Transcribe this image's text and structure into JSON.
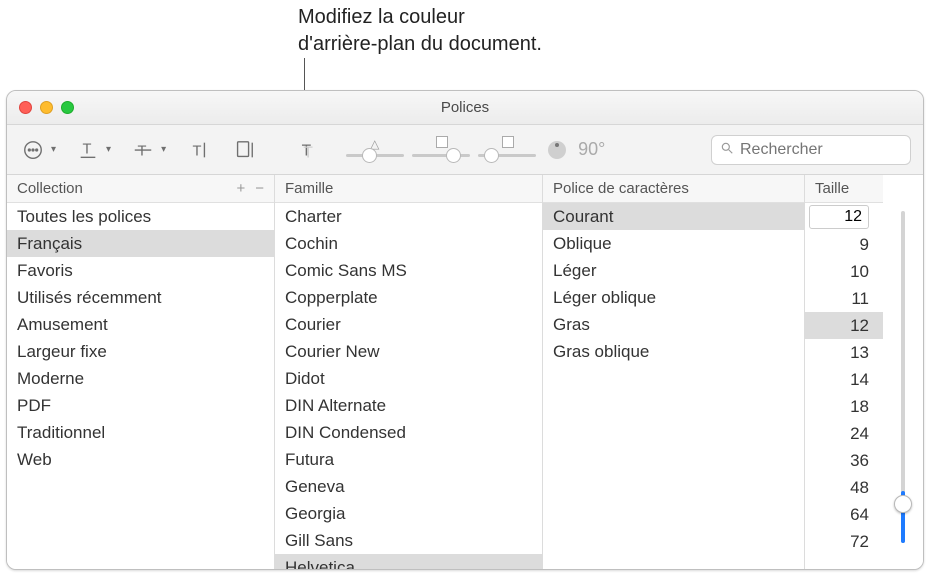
{
  "callout": {
    "line1": "Modifiez la couleur",
    "line2": "d'arrière-plan du document."
  },
  "window": {
    "title": "Polices",
    "search_placeholder": "Rechercher",
    "angle_label": "90°"
  },
  "headers": {
    "collection": "Collection",
    "family": "Famille",
    "typeface": "Police de caractères",
    "size": "Taille"
  },
  "collections": [
    {
      "label": "Toutes les polices",
      "selected": false
    },
    {
      "label": "Français",
      "selected": true
    },
    {
      "label": "Favoris",
      "selected": false
    },
    {
      "label": "Utilisés récemment",
      "selected": false
    },
    {
      "label": "Amusement",
      "selected": false
    },
    {
      "label": "Largeur fixe",
      "selected": false
    },
    {
      "label": "Moderne",
      "selected": false
    },
    {
      "label": "PDF",
      "selected": false
    },
    {
      "label": "Traditionnel",
      "selected": false
    },
    {
      "label": "Web",
      "selected": false
    }
  ],
  "families": [
    {
      "label": "Charter",
      "selected": false
    },
    {
      "label": "Cochin",
      "selected": false
    },
    {
      "label": "Comic Sans MS",
      "selected": false
    },
    {
      "label": "Copperplate",
      "selected": false
    },
    {
      "label": "Courier",
      "selected": false
    },
    {
      "label": "Courier New",
      "selected": false
    },
    {
      "label": "Didot",
      "selected": false
    },
    {
      "label": "DIN Alternate",
      "selected": false
    },
    {
      "label": "DIN Condensed",
      "selected": false
    },
    {
      "label": "Futura",
      "selected": false
    },
    {
      "label": "Geneva",
      "selected": false
    },
    {
      "label": "Georgia",
      "selected": false
    },
    {
      "label": "Gill Sans",
      "selected": false
    },
    {
      "label": "Helvetica",
      "selected": true
    }
  ],
  "typefaces": [
    {
      "label": "Courant",
      "selected": true
    },
    {
      "label": "Oblique",
      "selected": false
    },
    {
      "label": "Léger",
      "selected": false
    },
    {
      "label": "Léger oblique",
      "selected": false
    },
    {
      "label": "Gras",
      "selected": false
    },
    {
      "label": "Gras oblique",
      "selected": false
    }
  ],
  "size_input": "12",
  "sizes": [
    {
      "label": "9",
      "selected": false
    },
    {
      "label": "10",
      "selected": false
    },
    {
      "label": "11",
      "selected": false
    },
    {
      "label": "12",
      "selected": true
    },
    {
      "label": "13",
      "selected": false
    },
    {
      "label": "14",
      "selected": false
    },
    {
      "label": "18",
      "selected": false
    },
    {
      "label": "24",
      "selected": false
    },
    {
      "label": "36",
      "selected": false
    },
    {
      "label": "48",
      "selected": false
    },
    {
      "label": "64",
      "selected": false
    },
    {
      "label": "72",
      "selected": false
    }
  ]
}
